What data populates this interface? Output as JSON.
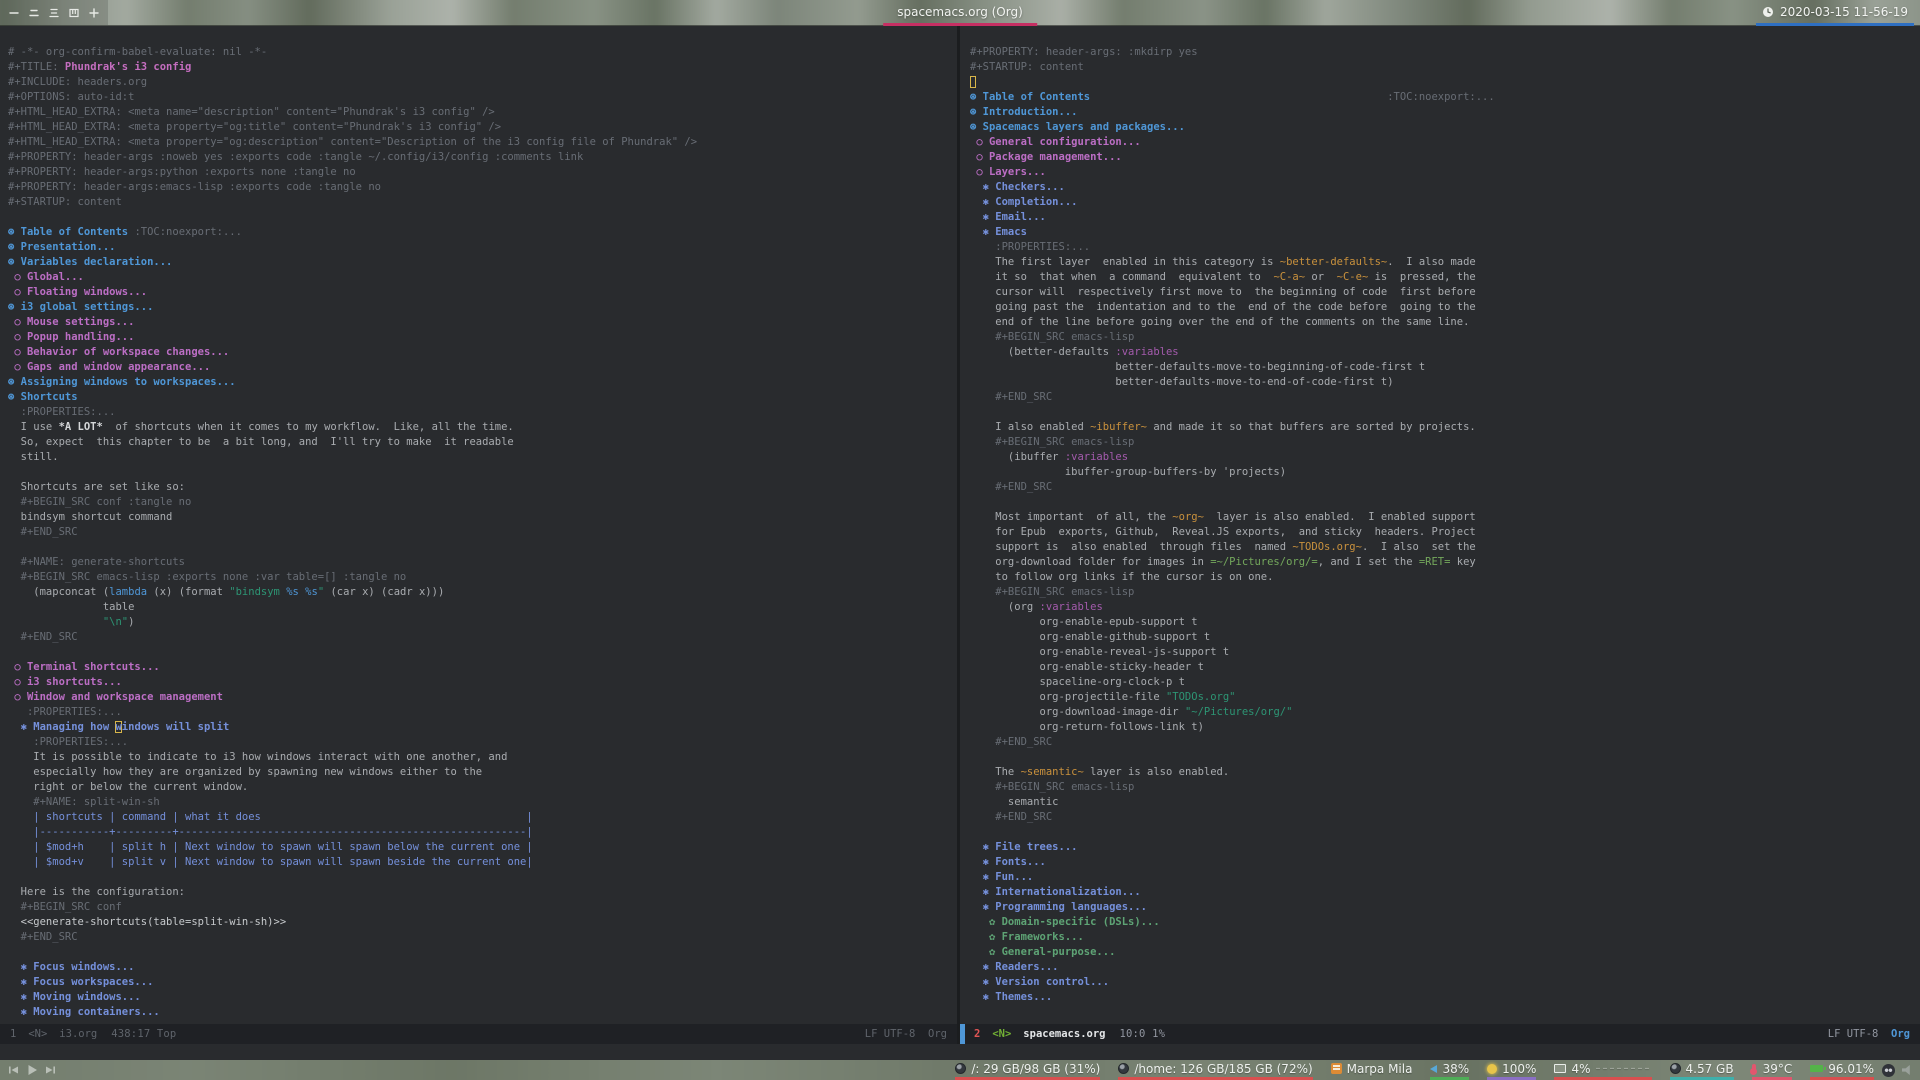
{
  "topbar": {
    "workspaces": [
      {
        "id": "workspace-1",
        "glyph": "一"
      },
      {
        "id": "workspace-2",
        "glyph": "二"
      },
      {
        "id": "workspace-3",
        "glyph": "三"
      },
      {
        "id": "workspace-4",
        "glyph": "四"
      },
      {
        "id": "workspace-new",
        "glyph": "+"
      }
    ],
    "window_title": "spacemacs.org (Org)",
    "clock": "2020-03-15 11-56-19",
    "title_underline": "#c62f63",
    "clock_underline": "#2e6fc2"
  },
  "theme": {
    "editor_bg": "#292b2e",
    "heading1": "#4f97d7",
    "heading2": "#bc6ec5",
    "heading3": "#7590db",
    "heading4": "#5ea475",
    "org_code": "#c9913d",
    "org_verbatim": "#74a85c",
    "string": "#2d9574",
    "meta": "#686d75"
  },
  "panes": {
    "left": {
      "lines": [
        [
          [
            "m",
            "# -*- org-confirm-babel-evaluate: nil -*-"
          ]
        ],
        [
          [
            "m",
            "#+TITLE: "
          ],
          [
            "t",
            "Phundrak's i3 config"
          ]
        ],
        [
          [
            "m",
            "#+INCLUDE: headers.org"
          ]
        ],
        [
          [
            "m",
            "#+OPTIONS: auto-id:t"
          ]
        ],
        [
          [
            "m",
            "#+HTML_HEAD_EXTRA: <meta name=\"description\" content=\"Phundrak's i3 config\" />"
          ]
        ],
        [
          [
            "m",
            "#+HTML_HEAD_EXTRA: <meta property=\"og:title\" content=\"Phundrak's i3 config\" />"
          ]
        ],
        [
          [
            "m",
            "#+HTML_HEAD_EXTRA: <meta property=\"og:description\" content=\"Description of the i3 config file of Phundrak\" />"
          ]
        ],
        [
          [
            "m",
            "#+PROPERTY: header-args :noweb yes :exports code :tangle ~/.config/i3/config :comments link"
          ]
        ],
        [
          [
            "m",
            "#+PROPERTY: header-args:python :exports none :tangle no"
          ]
        ],
        [
          [
            "m",
            "#+PROPERTY: header-args:emacs-lisp :exports code :tangle no"
          ]
        ],
        [
          [
            "m",
            "#+STARTUP: content"
          ]
        ],
        [],
        [
          [
            "h1",
            "⊛ Table of Contents "
          ],
          [
            "m",
            ":TOC:noexport:..."
          ]
        ],
        [
          [
            "h1",
            "⊛ Presentation..."
          ]
        ],
        [
          [
            "h1",
            "⊛ Variables declaration..."
          ]
        ],
        [
          [
            "h2",
            " ○ Global..."
          ]
        ],
        [
          [
            "h2",
            " ○ Floating windows..."
          ]
        ],
        [
          [
            "h1",
            "⊛ i3 global settings..."
          ]
        ],
        [
          [
            "h2",
            " ○ Mouse settings..."
          ]
        ],
        [
          [
            "h2",
            " ○ Popup handling..."
          ]
        ],
        [
          [
            "h2",
            " ○ Behavior of workspace changes..."
          ]
        ],
        [
          [
            "h2",
            " ○ Gaps and window appearance..."
          ]
        ],
        [
          [
            "h1",
            "⊛ Assigning windows to workspaces..."
          ]
        ],
        [
          [
            "h1",
            "⊛ Shortcuts"
          ]
        ],
        [
          [
            "m",
            "  :PROPERTIES:..."
          ]
        ],
        [
          [
            "d",
            "  I use "
          ],
          [
            "b",
            "*A LOT*"
          ],
          [
            "d",
            "  of shortcuts when it comes to my workflow.  Like, all the time."
          ]
        ],
        [
          [
            "d",
            "  So, expect  this chapter to be  a bit long, and  I'll try to make  it readable"
          ]
        ],
        [
          [
            "d",
            "  still."
          ]
        ],
        [],
        [
          [
            "d",
            "  Shortcuts are set like so:"
          ]
        ],
        [
          [
            "m",
            "  #+BEGIN_SRC conf :tangle no"
          ]
        ],
        [
          [
            "d",
            "  bindsym shortcut command"
          ]
        ],
        [
          [
            "m",
            "  #+END_SRC"
          ]
        ],
        [],
        [
          [
            "m",
            "  #+NAME: generate-shortcuts"
          ]
        ],
        [
          [
            "m",
            "  #+BEGIN_SRC emacs-lisp :exports none :var table=[] :tangle no"
          ]
        ],
        [
          [
            "d",
            "    (mapconcat ("
          ],
          [
            "f",
            "lambda"
          ],
          [
            "d",
            " (x) (format "
          ],
          [
            "s",
            "\"bindsym "
          ],
          [
            "f",
            "%s"
          ],
          [
            "s",
            " "
          ],
          [
            "f",
            "%s"
          ],
          [
            "s",
            "\""
          ],
          [
            "d",
            " (car x) (cadr x)))"
          ]
        ],
        [
          [
            "d",
            "               table"
          ]
        ],
        [
          [
            "d",
            "               "
          ],
          [
            "s",
            "\"\\n\""
          ],
          [
            "d",
            ")"
          ]
        ],
        [
          [
            "m",
            "  #+END_SRC"
          ]
        ],
        [],
        [
          [
            "h2",
            " ○ Terminal shortcuts..."
          ]
        ],
        [
          [
            "h2",
            " ○ i3 shortcuts..."
          ]
        ],
        [
          [
            "h2",
            " ○ Window and workspace management"
          ]
        ],
        [
          [
            "m",
            "   :PROPERTIES:..."
          ]
        ],
        [
          [
            "h3",
            "  ✱ Managing how "
          ],
          [
            "curh",
            "w"
          ],
          [
            "h3",
            "indows will split"
          ]
        ],
        [
          [
            "m",
            "    :PROPERTIES:..."
          ]
        ],
        [
          [
            "d",
            "    It is possible to indicate to i3 how windows interact with one another, and"
          ]
        ],
        [
          [
            "d",
            "    especially how they are organized by spawning new windows either to the"
          ]
        ],
        [
          [
            "d",
            "    right or below the current window."
          ]
        ],
        [
          [
            "m",
            "    #+NAME: split-win-sh"
          ]
        ],
        [
          [
            "tb",
            "    | shortcuts | command | what it does                                          |"
          ]
        ],
        [
          [
            "tb",
            "    |-----------+---------+-------------------------------------------------------|"
          ]
        ],
        [
          [
            "tb",
            "    | $mod+h    | split h | Next window to spawn will spawn below the current one |"
          ]
        ],
        [
          [
            "tb",
            "    | $mod+v    | split v | Next window to spawn will spawn beside the current one|"
          ]
        ],
        [],
        [
          [
            "d",
            "  Here is the configuration:"
          ]
        ],
        [
          [
            "m",
            "  #+BEGIN_SRC conf"
          ]
        ],
        [
          [
            "nw",
            "  <<generate-shortcuts(table=split-win-sh)>>"
          ]
        ],
        [
          [
            "m",
            "  #+END_SRC"
          ]
        ],
        [],
        [
          [
            "h3",
            "  ✱ Focus windows..."
          ]
        ],
        [
          [
            "h3",
            "  ✱ Focus workspaces..."
          ]
        ],
        [
          [
            "h3",
            "  ✱ Moving windows..."
          ]
        ],
        [
          [
            "h3",
            "  ✱ Moving containers..."
          ]
        ]
      ]
    },
    "right": {
      "lines": [
        [
          [
            "m",
            "#+PROPERTY: header-args: :mkdirp yes"
          ]
        ],
        [
          [
            "m",
            "#+STARTUP: content"
          ]
        ],
        [
          [
            "cur",
            " "
          ]
        ],
        [
          [
            "h1",
            "⊛ Table of Contents"
          ],
          [
            "m",
            "                                               :TOC:noexport:..."
          ]
        ],
        [
          [
            "h1",
            "⊛ Introduction..."
          ]
        ],
        [
          [
            "h1",
            "⊛ Spacemacs layers and packages..."
          ]
        ],
        [
          [
            "h2",
            " ○ General configuration..."
          ]
        ],
        [
          [
            "h2",
            " ○ Package management..."
          ]
        ],
        [
          [
            "h2",
            " ○ Layers..."
          ]
        ],
        [
          [
            "h3",
            "  ✱ Checkers..."
          ]
        ],
        [
          [
            "h3",
            "  ✱ Completion..."
          ]
        ],
        [
          [
            "h3",
            "  ✱ Email..."
          ]
        ],
        [
          [
            "h3",
            "  ✱ Emacs"
          ]
        ],
        [
          [
            "m",
            "    :PROPERTIES:..."
          ]
        ],
        [
          [
            "d",
            "    The first layer  enabled in this category is "
          ],
          [
            "o",
            "~better-defaults~"
          ],
          [
            "d",
            ".  I also made"
          ]
        ],
        [
          [
            "d",
            "    it so  that when  a command  equivalent to  "
          ],
          [
            "o",
            "~C-a~"
          ],
          [
            "d",
            " or  "
          ],
          [
            "o",
            "~C-e~"
          ],
          [
            "d",
            " is  pressed, the"
          ]
        ],
        [
          [
            "d",
            "    cursor will  respectively first move to  the beginning of code  first before"
          ]
        ],
        [
          [
            "d",
            "    going past the  indentation and to the  end of the code before  going to the"
          ]
        ],
        [
          [
            "d",
            "    end of the line before going over the end of the comments on the same line."
          ]
        ],
        [
          [
            "m",
            "    #+BEGIN_SRC emacs-lisp"
          ]
        ],
        [
          [
            "d",
            "      (better-defaults "
          ],
          [
            "k",
            ":variables"
          ]
        ],
        [
          [
            "d",
            "                       better-defaults-move-to-beginning-of-code-first t"
          ]
        ],
        [
          [
            "d",
            "                       better-defaults-move-to-end-of-code-first t)"
          ]
        ],
        [
          [
            "m",
            "    #+END_SRC"
          ]
        ],
        [],
        [
          [
            "d",
            "    I also enabled "
          ],
          [
            "o",
            "~ibuffer~"
          ],
          [
            "d",
            " and made it so that buffers are sorted by projects."
          ]
        ],
        [
          [
            "m",
            "    #+BEGIN_SRC emacs-lisp"
          ]
        ],
        [
          [
            "d",
            "      (ibuffer "
          ],
          [
            "k",
            ":variables"
          ]
        ],
        [
          [
            "d",
            "               ibuffer-group-buffers-by 'projects)"
          ]
        ],
        [
          [
            "m",
            "    #+END_SRC"
          ]
        ],
        [],
        [
          [
            "d",
            "    Most important  of all, the "
          ],
          [
            "o",
            "~org~"
          ],
          [
            "d",
            "  layer is also enabled.  I enabled support"
          ]
        ],
        [
          [
            "d",
            "    for Epub  exports, Github,  Reveal.JS exports,  and sticky  headers. Project"
          ]
        ],
        [
          [
            "d",
            "    support is  also enabled  through files  named "
          ],
          [
            "o",
            "~TODOs.org~"
          ],
          [
            "d",
            ".  I also  set the"
          ]
        ],
        [
          [
            "d",
            "    org-download folder for images in "
          ],
          [
            "v",
            "=~/Pictures/org/="
          ],
          [
            "d",
            ", and I set the "
          ],
          [
            "v",
            "=RET="
          ],
          [
            "d",
            " key"
          ]
        ],
        [
          [
            "d",
            "    to follow org links if the cursor is on one."
          ]
        ],
        [
          [
            "m",
            "    #+BEGIN_SRC emacs-lisp"
          ]
        ],
        [
          [
            "d",
            "      (org "
          ],
          [
            "k",
            ":variables"
          ]
        ],
        [
          [
            "d",
            "           org-enable-epub-support t"
          ]
        ],
        [
          [
            "d",
            "           org-enable-github-support t"
          ]
        ],
        [
          [
            "d",
            "           org-enable-reveal-js-support t"
          ]
        ],
        [
          [
            "d",
            "           org-enable-sticky-header t"
          ]
        ],
        [
          [
            "d",
            "           spaceline-org-clock-p t"
          ]
        ],
        [
          [
            "d",
            "           org-projectile-file "
          ],
          [
            "s",
            "\"TODOs.org\""
          ]
        ],
        [
          [
            "d",
            "           org-download-image-dir "
          ],
          [
            "s",
            "\"~/Pictures/org/\""
          ]
        ],
        [
          [
            "d",
            "           org-return-follows-link t)"
          ]
        ],
        [
          [
            "m",
            "    #+END_SRC"
          ]
        ],
        [],
        [
          [
            "d",
            "    The "
          ],
          [
            "o",
            "~semantic~"
          ],
          [
            "d",
            " layer is also enabled."
          ]
        ],
        [
          [
            "m",
            "    #+BEGIN_SRC emacs-lisp"
          ]
        ],
        [
          [
            "d",
            "      semantic"
          ]
        ],
        [
          [
            "m",
            "    #+END_SRC"
          ]
        ],
        [],
        [
          [
            "h3",
            "  ✱ File trees..."
          ]
        ],
        [
          [
            "h3",
            "  ✱ Fonts..."
          ]
        ],
        [
          [
            "h3",
            "  ✱ Fun..."
          ]
        ],
        [
          [
            "h3",
            "  ✱ Internationalization..."
          ]
        ],
        [
          [
            "h3",
            "  ✱ Programming languages..."
          ]
        ],
        [
          [
            "h4",
            "   ✿ Domain-specific (DSLs)..."
          ]
        ],
        [
          [
            "h4",
            "   ✿ Frameworks..."
          ]
        ],
        [
          [
            "h4",
            "   ✿ General-purpose..."
          ]
        ],
        [
          [
            "h3",
            "  ✱ Readers..."
          ]
        ],
        [
          [
            "h3",
            "  ✱ Version control..."
          ]
        ],
        [
          [
            "h3",
            "  ✱ Themes..."
          ]
        ]
      ]
    }
  },
  "modelines": {
    "left": {
      "window": "1",
      "state": "<N>",
      "buffer": "i3.org",
      "position": "438:17 Top",
      "eol": "LF",
      "encoding": "UTF-8",
      "mode": "Org"
    },
    "right": {
      "window": "2",
      "state": "<N>",
      "buffer": "spacemacs.org",
      "position": "10:0  1%",
      "eol": "LF",
      "encoding": "UTF-8",
      "mode": "Org"
    }
  },
  "statusbar": {
    "playback": [
      {
        "id": "previous",
        "symbol": "prev"
      },
      {
        "id": "play",
        "symbol": "play"
      },
      {
        "id": "next",
        "symbol": "next"
      }
    ],
    "modules": [
      {
        "name": "disk-root",
        "icon": "disk",
        "label": "/: 29 GB/98 GB (31%)",
        "underline": "#d94f4f"
      },
      {
        "name": "disk-home",
        "icon": "disk",
        "label": "/home: 126 GB/185 GB (72%)",
        "underline": "#d94f4f"
      },
      {
        "name": "music",
        "icon": "music",
        "label": "Marpa Mila",
        "underline": null
      },
      {
        "name": "volume",
        "icon": "volume",
        "label": "38%",
        "underline": "#4fae57"
      },
      {
        "name": "brightness",
        "icon": "sun",
        "label": "100%",
        "underline": "#8a6fc4"
      },
      {
        "name": "cpu",
        "icon": "cpu",
        "label": "4%",
        "graph": "––––––––",
        "underline": "#d94f4f"
      },
      {
        "name": "memory",
        "icon": "mem",
        "label": "4.57 GB",
        "underline": "#3fb0ab"
      },
      {
        "name": "temperature",
        "icon": "temp",
        "label": "39°C",
        "underline": "#e0566e"
      },
      {
        "name": "battery",
        "icon": "battery",
        "label": "96.01%",
        "underline": "#d94f4f"
      }
    ],
    "tray": [
      "discord",
      "audio"
    ]
  }
}
